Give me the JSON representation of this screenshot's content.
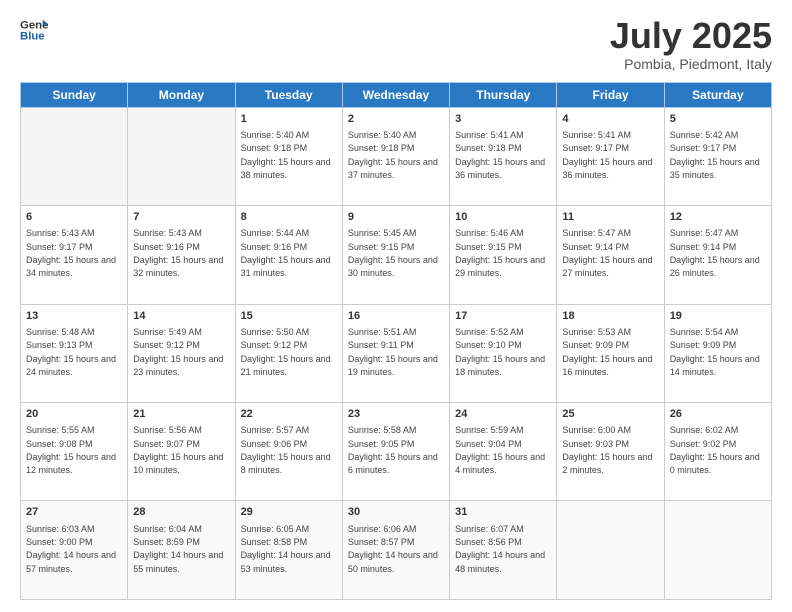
{
  "logo": {
    "line1": "General",
    "line2": "Blue"
  },
  "title": "July 2025",
  "location": "Pombia, Piedmont, Italy",
  "days_header": [
    "Sunday",
    "Monday",
    "Tuesday",
    "Wednesday",
    "Thursday",
    "Friday",
    "Saturday"
  ],
  "weeks": [
    [
      {
        "day": "",
        "sunrise": "",
        "sunset": "",
        "daylight": ""
      },
      {
        "day": "",
        "sunrise": "",
        "sunset": "",
        "daylight": ""
      },
      {
        "day": "1",
        "sunrise": "Sunrise: 5:40 AM",
        "sunset": "Sunset: 9:18 PM",
        "daylight": "Daylight: 15 hours and 38 minutes."
      },
      {
        "day": "2",
        "sunrise": "Sunrise: 5:40 AM",
        "sunset": "Sunset: 9:18 PM",
        "daylight": "Daylight: 15 hours and 37 minutes."
      },
      {
        "day": "3",
        "sunrise": "Sunrise: 5:41 AM",
        "sunset": "Sunset: 9:18 PM",
        "daylight": "Daylight: 15 hours and 36 minutes."
      },
      {
        "day": "4",
        "sunrise": "Sunrise: 5:41 AM",
        "sunset": "Sunset: 9:17 PM",
        "daylight": "Daylight: 15 hours and 36 minutes."
      },
      {
        "day": "5",
        "sunrise": "Sunrise: 5:42 AM",
        "sunset": "Sunset: 9:17 PM",
        "daylight": "Daylight: 15 hours and 35 minutes."
      }
    ],
    [
      {
        "day": "6",
        "sunrise": "Sunrise: 5:43 AM",
        "sunset": "Sunset: 9:17 PM",
        "daylight": "Daylight: 15 hours and 34 minutes."
      },
      {
        "day": "7",
        "sunrise": "Sunrise: 5:43 AM",
        "sunset": "Sunset: 9:16 PM",
        "daylight": "Daylight: 15 hours and 32 minutes."
      },
      {
        "day": "8",
        "sunrise": "Sunrise: 5:44 AM",
        "sunset": "Sunset: 9:16 PM",
        "daylight": "Daylight: 15 hours and 31 minutes."
      },
      {
        "day": "9",
        "sunrise": "Sunrise: 5:45 AM",
        "sunset": "Sunset: 9:15 PM",
        "daylight": "Daylight: 15 hours and 30 minutes."
      },
      {
        "day": "10",
        "sunrise": "Sunrise: 5:46 AM",
        "sunset": "Sunset: 9:15 PM",
        "daylight": "Daylight: 15 hours and 29 minutes."
      },
      {
        "day": "11",
        "sunrise": "Sunrise: 5:47 AM",
        "sunset": "Sunset: 9:14 PM",
        "daylight": "Daylight: 15 hours and 27 minutes."
      },
      {
        "day": "12",
        "sunrise": "Sunrise: 5:47 AM",
        "sunset": "Sunset: 9:14 PM",
        "daylight": "Daylight: 15 hours and 26 minutes."
      }
    ],
    [
      {
        "day": "13",
        "sunrise": "Sunrise: 5:48 AM",
        "sunset": "Sunset: 9:13 PM",
        "daylight": "Daylight: 15 hours and 24 minutes."
      },
      {
        "day": "14",
        "sunrise": "Sunrise: 5:49 AM",
        "sunset": "Sunset: 9:12 PM",
        "daylight": "Daylight: 15 hours and 23 minutes."
      },
      {
        "day": "15",
        "sunrise": "Sunrise: 5:50 AM",
        "sunset": "Sunset: 9:12 PM",
        "daylight": "Daylight: 15 hours and 21 minutes."
      },
      {
        "day": "16",
        "sunrise": "Sunrise: 5:51 AM",
        "sunset": "Sunset: 9:11 PM",
        "daylight": "Daylight: 15 hours and 19 minutes."
      },
      {
        "day": "17",
        "sunrise": "Sunrise: 5:52 AM",
        "sunset": "Sunset: 9:10 PM",
        "daylight": "Daylight: 15 hours and 18 minutes."
      },
      {
        "day": "18",
        "sunrise": "Sunrise: 5:53 AM",
        "sunset": "Sunset: 9:09 PM",
        "daylight": "Daylight: 15 hours and 16 minutes."
      },
      {
        "day": "19",
        "sunrise": "Sunrise: 5:54 AM",
        "sunset": "Sunset: 9:09 PM",
        "daylight": "Daylight: 15 hours and 14 minutes."
      }
    ],
    [
      {
        "day": "20",
        "sunrise": "Sunrise: 5:55 AM",
        "sunset": "Sunset: 9:08 PM",
        "daylight": "Daylight: 15 hours and 12 minutes."
      },
      {
        "day": "21",
        "sunrise": "Sunrise: 5:56 AM",
        "sunset": "Sunset: 9:07 PM",
        "daylight": "Daylight: 15 hours and 10 minutes."
      },
      {
        "day": "22",
        "sunrise": "Sunrise: 5:57 AM",
        "sunset": "Sunset: 9:06 PM",
        "daylight": "Daylight: 15 hours and 8 minutes."
      },
      {
        "day": "23",
        "sunrise": "Sunrise: 5:58 AM",
        "sunset": "Sunset: 9:05 PM",
        "daylight": "Daylight: 15 hours and 6 minutes."
      },
      {
        "day": "24",
        "sunrise": "Sunrise: 5:59 AM",
        "sunset": "Sunset: 9:04 PM",
        "daylight": "Daylight: 15 hours and 4 minutes."
      },
      {
        "day": "25",
        "sunrise": "Sunrise: 6:00 AM",
        "sunset": "Sunset: 9:03 PM",
        "daylight": "Daylight: 15 hours and 2 minutes."
      },
      {
        "day": "26",
        "sunrise": "Sunrise: 6:02 AM",
        "sunset": "Sunset: 9:02 PM",
        "daylight": "Daylight: 15 hours and 0 minutes."
      }
    ],
    [
      {
        "day": "27",
        "sunrise": "Sunrise: 6:03 AM",
        "sunset": "Sunset: 9:00 PM",
        "daylight": "Daylight: 14 hours and 57 minutes."
      },
      {
        "day": "28",
        "sunrise": "Sunrise: 6:04 AM",
        "sunset": "Sunset: 8:59 PM",
        "daylight": "Daylight: 14 hours and 55 minutes."
      },
      {
        "day": "29",
        "sunrise": "Sunrise: 6:05 AM",
        "sunset": "Sunset: 8:58 PM",
        "daylight": "Daylight: 14 hours and 53 minutes."
      },
      {
        "day": "30",
        "sunrise": "Sunrise: 6:06 AM",
        "sunset": "Sunset: 8:57 PM",
        "daylight": "Daylight: 14 hours and 50 minutes."
      },
      {
        "day": "31",
        "sunrise": "Sunrise: 6:07 AM",
        "sunset": "Sunset: 8:56 PM",
        "daylight": "Daylight: 14 hours and 48 minutes."
      },
      {
        "day": "",
        "sunrise": "",
        "sunset": "",
        "daylight": ""
      },
      {
        "day": "",
        "sunrise": "",
        "sunset": "",
        "daylight": ""
      }
    ]
  ]
}
